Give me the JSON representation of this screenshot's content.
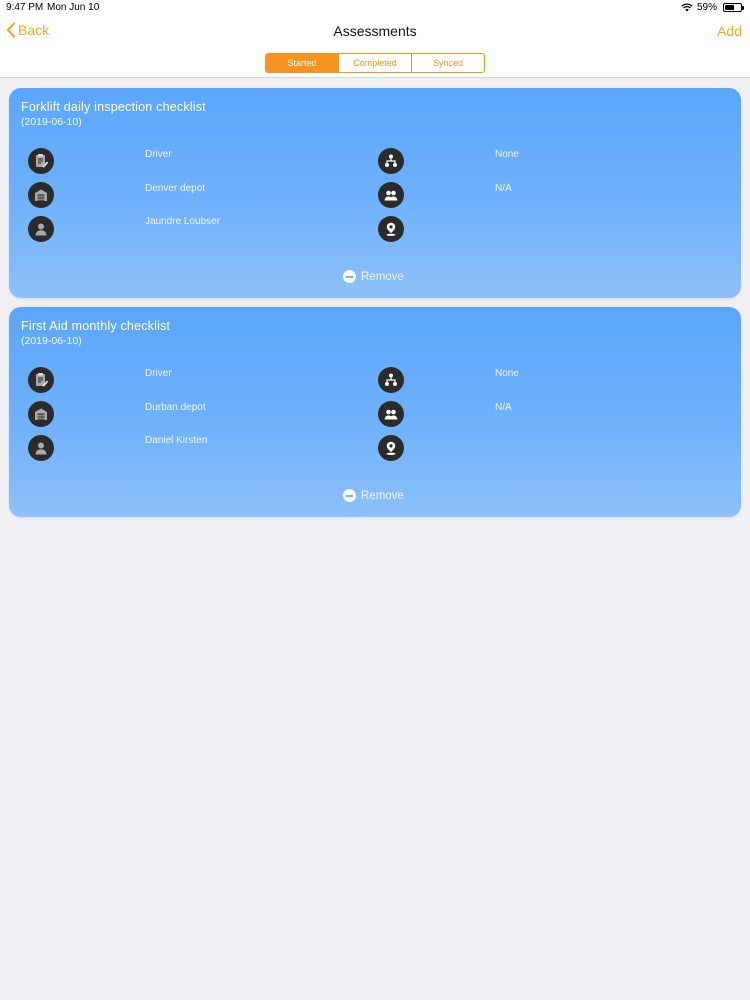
{
  "status": {
    "time": "9:47 PM",
    "date": "Mon Jun 10",
    "battery": "59%"
  },
  "nav": {
    "back_label": "Back",
    "title": "Assessments",
    "add_label": "Add"
  },
  "segments": {
    "started": "Started",
    "completed": "Completed",
    "synced": "Synced",
    "selected": "Started"
  },
  "colors": {
    "accent": "#f7931e",
    "card_top": "#5aa6fb",
    "card_bottom": "#8ec1fa",
    "icon_bg": "#2b2b2b"
  },
  "assessments": [
    {
      "title": "Forklift daily inspection checklist",
      "date": "(2019-06-10)",
      "role": "Driver",
      "depot": "Denver depot",
      "person": "Jaundre Loubser",
      "supervisor": "None",
      "group": "N/A",
      "location": "",
      "remove_label": "Remove"
    },
    {
      "title": "First Aid monthly checklist",
      "date": "(2019-06-10)",
      "role": "Driver",
      "depot": "Durban depot",
      "person": "Daniel Kirsten",
      "supervisor": "None",
      "group": "N/A",
      "location": "",
      "remove_label": "Remove"
    }
  ],
  "icons": [
    "clipboard-edit-icon",
    "warehouse-icon",
    "person-icon",
    "org-hierarchy-icon",
    "group-icon",
    "location-pin-icon",
    "remove-icon",
    "back-chevron-icon",
    "wifi-icon",
    "battery-icon"
  ]
}
